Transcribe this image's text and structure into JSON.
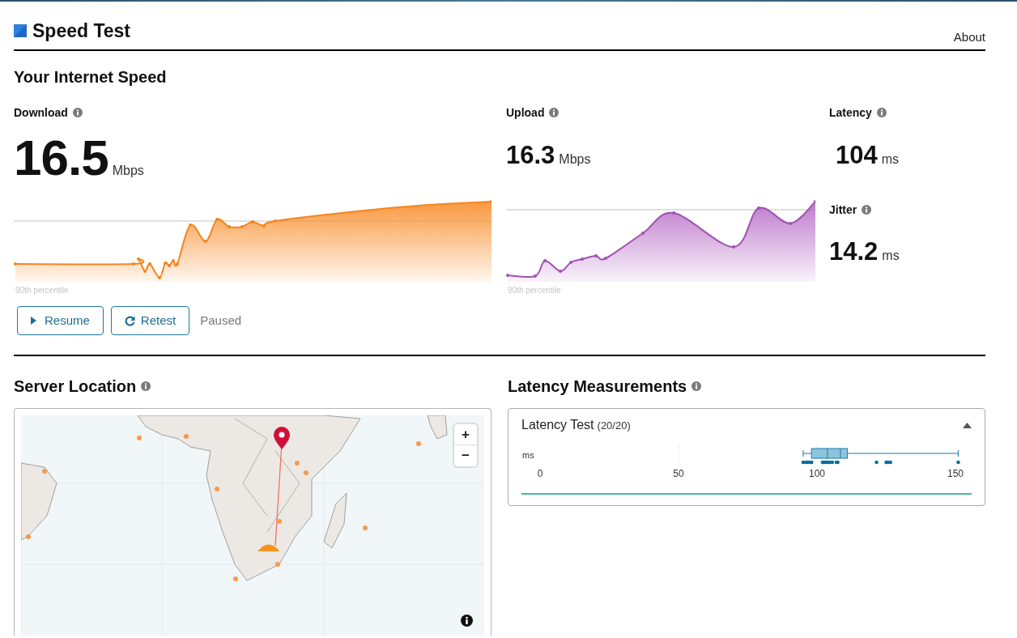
{
  "header": {
    "title": "Speed Test",
    "nav_link": "About"
  },
  "speed": {
    "heading": "Your Internet Speed",
    "download": {
      "label": "Download",
      "value": "16.5",
      "unit": "Mbps",
      "percentile_label": "90th percentile"
    },
    "upload": {
      "label": "Upload",
      "value": "16.3",
      "unit": "Mbps",
      "percentile_label": "90th percentile"
    },
    "latency": {
      "label": "Latency",
      "value": "104",
      "unit": "ms"
    },
    "jitter": {
      "label": "Jitter",
      "value": "14.2",
      "unit": "ms"
    },
    "buttons": [
      {
        "kind": "resume",
        "label": "Resume"
      },
      {
        "kind": "retest",
        "label": "Retest"
      }
    ],
    "status": "Paused"
  },
  "server_location": {
    "heading": "Server Location",
    "map": {
      "kind": "picture",
      "zoom_in": "+",
      "zoom_out": "−"
    }
  },
  "latency_measurements": {
    "heading": "Latency Measurements",
    "panel": {
      "title": "Latency Test",
      "count": "(20/20)",
      "expanded": true,
      "level": 1,
      "axis_unit": "ms",
      "axis_labels": [
        "0",
        "50",
        "100",
        "150"
      ]
    }
  }
}
